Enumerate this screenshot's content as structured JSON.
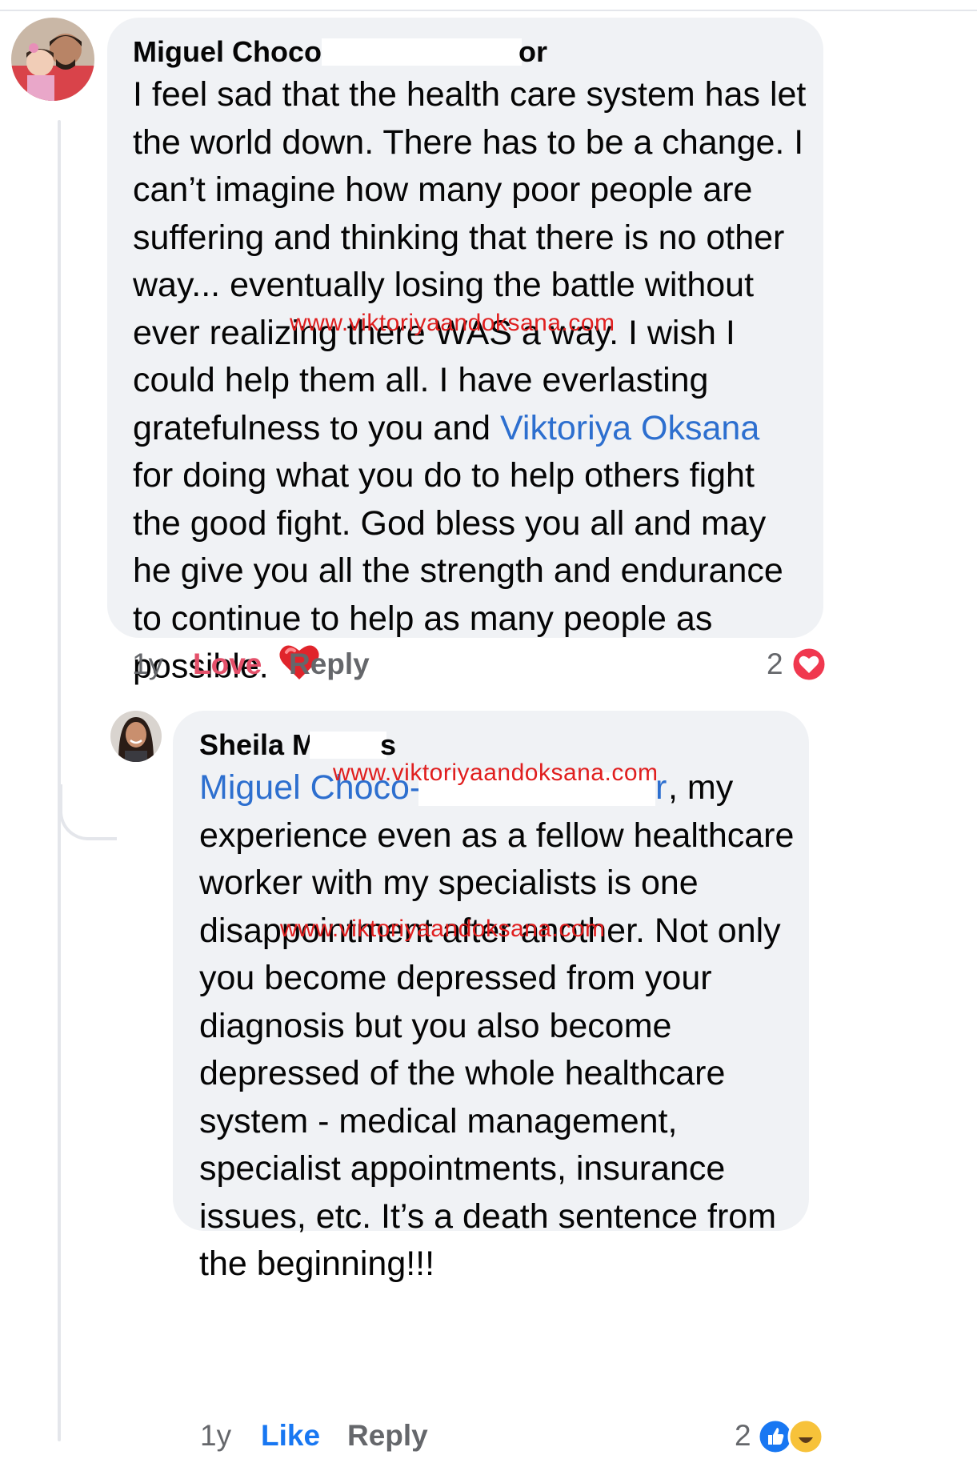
{
  "comment": {
    "author_visible": "Miguel Choco-",
    "author_tail": "or",
    "text_before_mention": "I feel sad that the health care system has let\nthe world down. There has to be a change. I\ncan’t imagine how many poor people are\nsuffering and thinking that there is no other\nway... eventually losing the battle without\never realizing there WAS a way. I wish I\ncould help them all. I have everlasting\ngratefulness to you and ",
    "mention": "Viktoriya Oksana",
    "text_after_mention": "\nfor doing what you do to help others fight\nthe good fight. God bless you all and may\nhe give you all the strength and endurance\nto continue to help as many people as\npossible. ",
    "emoji": "red-heart",
    "time": "1y",
    "reaction_label": "Love",
    "reply_label": "Reply",
    "reaction_count": "2",
    "reaction_icon": "love-reaction-icon"
  },
  "reply": {
    "author_visible": "Sheila M",
    "author_tail": "s",
    "mention_visible": "Miguel Choco-",
    "mention_tail": "r",
    "text": ", my\nexperience even as a fellow healthcare\nworker with my specialists is one\ndisappointment after another. Not only\nyou become depressed from your\ndiagnosis but you also become\ndepressed of the whole healthcare\nsystem - medical management,\nspecialist appointments, insurance\nissues, etc. It’s a death sentence from\nthe beginning!!!",
    "time": "1y",
    "like_label": "Like",
    "reply_label": "Reply",
    "reaction_count": "2",
    "reaction_icons": [
      "like-reaction-icon",
      "haha-reaction-icon"
    ]
  },
  "watermark": "www.viktoriyaandoksana.com",
  "colors": {
    "bubble": "#f0f2f5",
    "mention": "#2d6fcf",
    "love": "#e4506a",
    "watermark": "#e01f1f",
    "meta": "#65676b"
  }
}
